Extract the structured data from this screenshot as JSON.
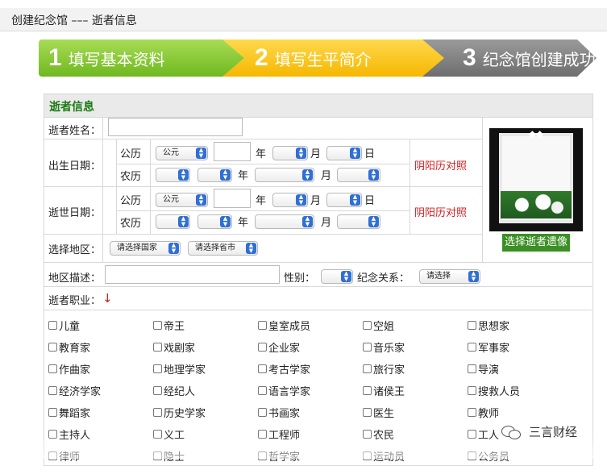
{
  "header": {
    "title": "创建纪念馆 ––– 逝者信息"
  },
  "steps": [
    {
      "num": "1",
      "label": "填写基本资料"
    },
    {
      "num": "2",
      "label": "填写生平简介"
    },
    {
      "num": "3",
      "label": "纪念馆创建成功"
    }
  ],
  "section_title": "逝者信息",
  "form": {
    "name_label": "逝者姓名：",
    "birth_label": "出生日期：",
    "death_label": "逝世日期：",
    "gregorian": "公历",
    "lunar": "农历",
    "era_value": "公元",
    "year": "年",
    "month": "月",
    "day": "日",
    "lunar_link": "阴阳历对照",
    "region_label": "选择地区：",
    "country_select": "请选择国家",
    "province_select": "请选择省市",
    "region_desc_label": "地区描述：",
    "gender_label": "性别：",
    "relation_label": "纪念关系：",
    "relation_select": "请选择",
    "occupation_label": "逝者职业：",
    "arrow": "↓"
  },
  "photo_button": "选择逝者遗像",
  "occupations": [
    [
      "儿童",
      "帝王",
      "皇室成员",
      "空姐",
      "思想家"
    ],
    [
      "教育家",
      "戏剧家",
      "企业家",
      "音乐家",
      "军事家"
    ],
    [
      "作曲家",
      "地理学家",
      "考古学家",
      "旅行家",
      "导演"
    ],
    [
      "经济学家",
      "经纪人",
      "语言学家",
      "诸侯王",
      "搜救人员"
    ],
    [
      "舞蹈家",
      "历史学家",
      "书画家",
      "医生",
      "教师"
    ],
    [
      "主持人",
      "义工",
      "工程师",
      "农民",
      "工人"
    ],
    [
      "律师",
      "隐士",
      "哲学家",
      "运动员",
      "公务员"
    ]
  ],
  "watermark": "三言财经",
  "colors": {
    "green_title": "#1c7a14",
    "red_link": "#d41d1d",
    "photo_button": "#3b8f24"
  }
}
